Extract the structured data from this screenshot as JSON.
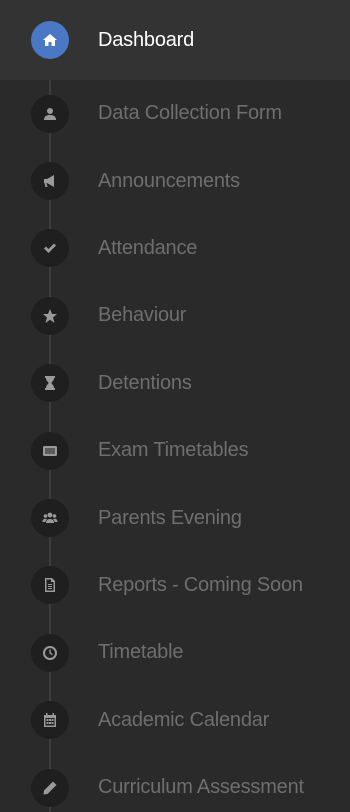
{
  "colors": {
    "background": "#2a2a2a",
    "active_background": "#333333",
    "active_icon": "#4a78c4",
    "icon_circle": "#1f1f1f",
    "label": "#6e6e6e",
    "label_active": "#ffffff"
  },
  "sidebar": {
    "items": [
      {
        "label": "Dashboard",
        "icon": "home-icon",
        "active": true
      },
      {
        "label": "Data Collection Form",
        "icon": "user-icon",
        "active": false
      },
      {
        "label": "Announcements",
        "icon": "megaphone-icon",
        "active": false
      },
      {
        "label": "Attendance",
        "icon": "check-icon",
        "active": false
      },
      {
        "label": "Behaviour",
        "icon": "star-icon",
        "active": false
      },
      {
        "label": "Detentions",
        "icon": "hourglass-icon",
        "active": false
      },
      {
        "label": "Exam Timetables",
        "icon": "list-icon",
        "active": false
      },
      {
        "label": "Parents Evening",
        "icon": "users-icon",
        "active": false
      },
      {
        "label": "Reports - Coming Soon",
        "icon": "document-icon",
        "active": false
      },
      {
        "label": "Timetable",
        "icon": "clock-icon",
        "active": false
      },
      {
        "label": "Academic Calendar",
        "icon": "calendar-icon",
        "active": false
      },
      {
        "label": "Curriculum Assessment",
        "icon": "pencil-icon",
        "active": false
      }
    ]
  }
}
